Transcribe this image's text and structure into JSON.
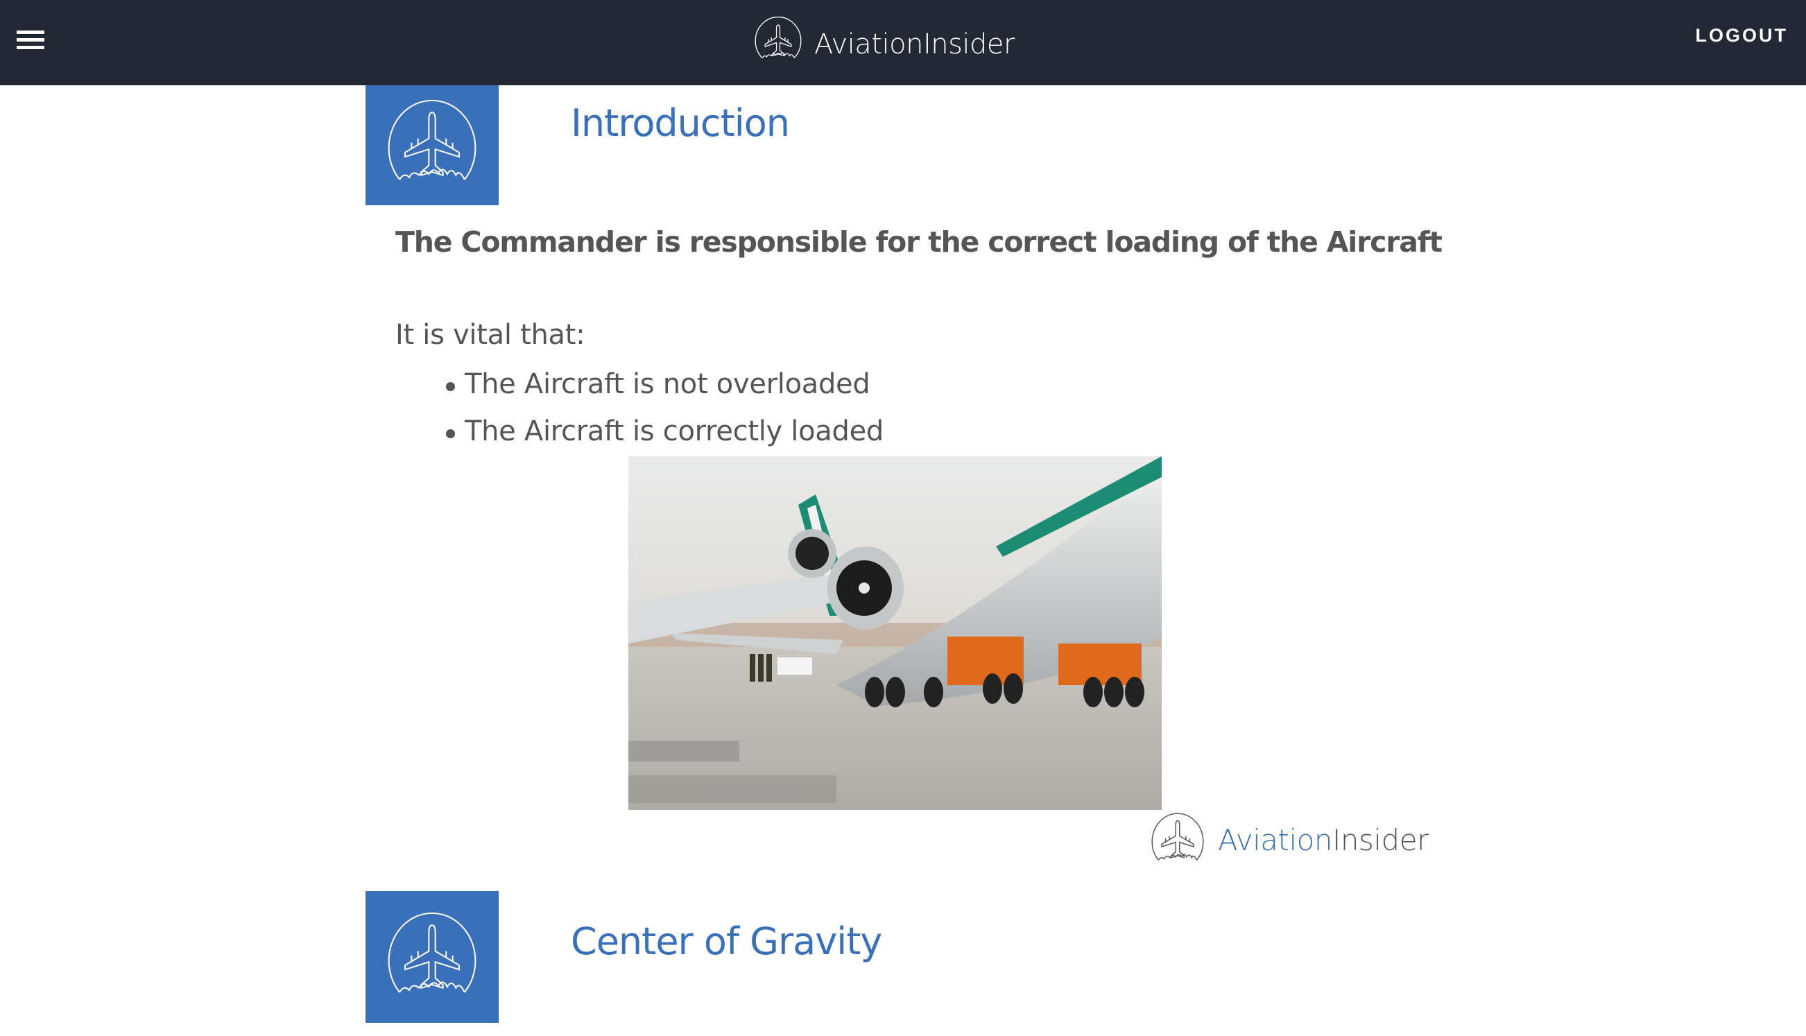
{
  "header": {
    "menu_icon": "hamburger-menu-icon",
    "brand": {
      "icon": "airplane-circle-logo-icon",
      "name": "AviationInsider"
    },
    "logout_label": "LOGOUT"
  },
  "colors": {
    "header_bg": "#222935",
    "accent_blue": "#3a70b9",
    "body_text": "#555555"
  },
  "sections": [
    {
      "icon": "airplane-circle-icon",
      "title": "Introduction",
      "lead": "The Commander is responsible for the correct loading of the Aircraft",
      "intro_line": "It is vital that:",
      "bullets": [
        "The Aircraft is not overloaded",
        "The Aircraft is correctly loaded"
      ],
      "image": {
        "alt": "Widebody aircraft on apron with ground crew and orange loading equipment",
        "watermark": {
          "part1": "Aviation",
          "part2": "Insider"
        }
      }
    },
    {
      "icon": "airplane-circle-icon",
      "title": "Center of Gravity"
    }
  ]
}
